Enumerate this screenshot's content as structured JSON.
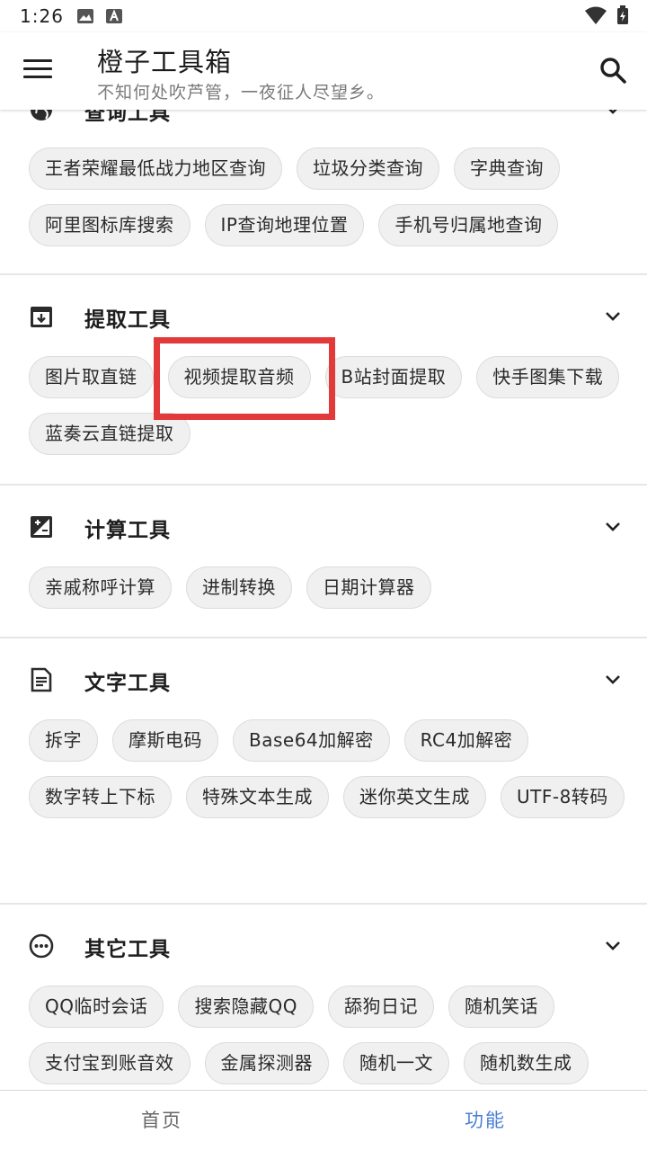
{
  "status_bar": {
    "time": "1:26"
  },
  "app_bar": {
    "title": "橙子工具箱",
    "subtitle": "不知何处吹芦管，一夜征人尽望乡。",
    "menu_icon": "hamburger-menu-icon",
    "search_icon": "search-icon"
  },
  "sections": [
    {
      "title": "查询工具",
      "icon": "globe-icon",
      "chips": [
        "王者荣耀最低战力地区查询",
        "垃圾分类查询",
        "字典查询",
        "阿里图标库搜索",
        "IP查询地理位置",
        "手机号归属地查询"
      ]
    },
    {
      "title": "提取工具",
      "icon": "archive-download-icon",
      "chips": [
        "图片取直链",
        "视频提取音频",
        "B站封面提取",
        "快手图集下载",
        "蓝奏云直链提取"
      ]
    },
    {
      "title": "计算工具",
      "icon": "calculator-icon",
      "chips": [
        "亲戚称呼计算",
        "进制转换",
        "日期计算器"
      ]
    },
    {
      "title": "文字工具",
      "icon": "document-icon",
      "chips": [
        "拆字",
        "摩斯电码",
        "Base64加解密",
        "RC4加解密",
        "数字转上下标",
        "特殊文本生成",
        "迷你英文生成",
        "UTF-8转码"
      ]
    },
    {
      "title": "其它工具",
      "icon": "more-circle-icon",
      "chips": [
        "QQ临时会话",
        "搜索隐藏QQ",
        "舔狗日记",
        "随机笑话",
        "支付宝到账音效",
        "金属探测器",
        "随机一文",
        "随机数生成"
      ]
    }
  ],
  "bottom_nav": {
    "items": [
      "首页",
      "功能"
    ],
    "active": "功能",
    "active_color": "#4a7fd8"
  },
  "highlight_color": "#e23a3a"
}
